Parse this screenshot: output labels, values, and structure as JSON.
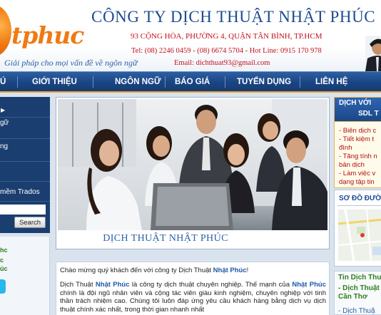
{
  "header": {
    "logo_text": "tphuc",
    "slogan": "Giải pháp cho mọi vấn đề về ngôn ngữ",
    "company_name": "CÔNG TY DỊCH THUẬT NHẬT PHÚC",
    "address": "93 CỘNG HÒA, PHƯỜNG 4, QUẬN TÂN BÌNH, TP.HCM",
    "phones": "Tel: (08) 2246 0459 - (08) 6674 5704 - Hot Line: 0915 170 978",
    "email": "Email: dichthuat93@gmail.com"
  },
  "nav": {
    "items": [
      {
        "label": "Ú"
      },
      {
        "label": "GIỚI THIỆU"
      },
      {
        "label": "NGÔN NGỮ"
      },
      {
        "label": "BÁO GIÁ"
      },
      {
        "label": "TUYỂN DỤNG"
      },
      {
        "label": "LIÊN HỆ"
      }
    ]
  },
  "left": {
    "items": [
      "gữ",
      "ng",
      "mềm Trados"
    ],
    "search_value": "",
    "search_button": "Search",
    "links": [
      "hc",
      "c",
      "úc"
    ]
  },
  "banner": {
    "caption": "DỊCH THUẬT NHẬT PHÚC"
  },
  "intro": {
    "welcome_prefix": "Chào mừng quý khách đến với công ty Dịch Thuật ",
    "welcome_brand": "Nhật Phúc",
    "welcome_suffix": "!",
    "p1": "Dịch Thuật ",
    "p1_brand": "Nhật Phúc",
    "p2": " là công ty dịch thuật chuyên nghiệp. Thế mạnh của ",
    "p2_brand": "Nhật Phúc",
    "p3": " chính là đội ngũ nhân viên và cộng tác viên giàu kinh nghiệm, chuyên nghiệp với tinh thần trách nhiệm cao. Chúng tôi luôn đáp ứng yêu cầu khách hàng bằng dịch vụ dịch thuật chính xác nhất, trong thời gian nhanh nhất"
  },
  "right": {
    "header_line1": "DỊCH VỚI",
    "header_line2": "SDL T",
    "bullets": [
      "- Biên dịch c",
      "- Tiết kiệm t",
      "đình",
      "- Tăng tính n",
      "bản dịch",
      "- Làm việc v",
      "dạng tập tin"
    ],
    "map_title": "SƠ ĐỒ ĐƯỜ",
    "news_title": "Tin Dịch Thuậ",
    "news_items": [
      "- Dịch Thuật",
      "Cần Thơ",
      "- Dịch Thuậ"
    ]
  },
  "colors": {
    "nav_bg": "#1a4583",
    "nav_accent": "#e8a030",
    "brand_orange": "#f07a12",
    "title_blue": "#1d4c8f",
    "contact_red": "#c40f1c",
    "left_panel": "#1b3e71"
  }
}
